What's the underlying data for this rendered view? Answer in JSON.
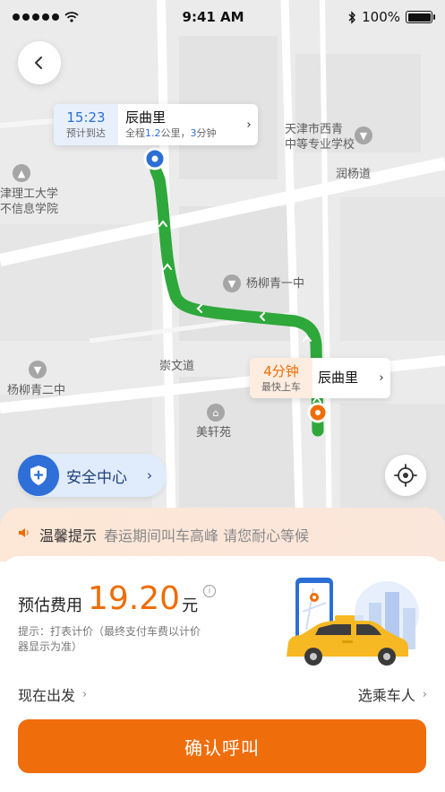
{
  "status_bar": {
    "time": "9:41 AM",
    "battery": "100%",
    "battery_level": 1.0
  },
  "map": {
    "labels": {
      "school_top_right": [
        "天津市西青",
        "中等专业学校"
      ],
      "road_runyang": "润杨道",
      "school_left": [
        "津理工大学",
        "不信息学院"
      ],
      "yangliuqing_one": "杨柳青一中",
      "road_chongwen": "崇文道",
      "yangliuqing_two": "杨柳青二中",
      "meixuanyuan": "美轩苑"
    }
  },
  "destination_card": {
    "eta_time": "15:23",
    "eta_label": "预计到达",
    "title": "辰曲里",
    "distance_prefix": "全程",
    "distance_value": "1.2",
    "distance_unit": "公里，",
    "duration_value": "3",
    "duration_unit": "分钟"
  },
  "pickup_card": {
    "minutes": "4分钟",
    "sub": "最快上车",
    "title": "辰曲里"
  },
  "safety_center": {
    "label": "安全中心"
  },
  "tip": {
    "title": "温馨提示",
    "text": "春运期间叫车高峰 请您耐心等候"
  },
  "fare": {
    "label": "预估费用",
    "value": "19.20",
    "unit": "元",
    "note": "提示：打表计价（最终支付车费以计价器显示为准）"
  },
  "options": {
    "depart": "现在出发",
    "passenger": "选乘车人"
  },
  "confirm_button": {
    "label": "确认呼叫"
  },
  "colors": {
    "route": "#2ea83a",
    "accent_orange": "#f06d0c",
    "accent_blue": "#2b6fd6"
  },
  "icons": [
    "wifi-icon",
    "bluetooth-icon",
    "back-arrow-icon",
    "shield-icon",
    "locate-icon",
    "speaker-icon",
    "info-icon",
    "taxi-illustration"
  ]
}
